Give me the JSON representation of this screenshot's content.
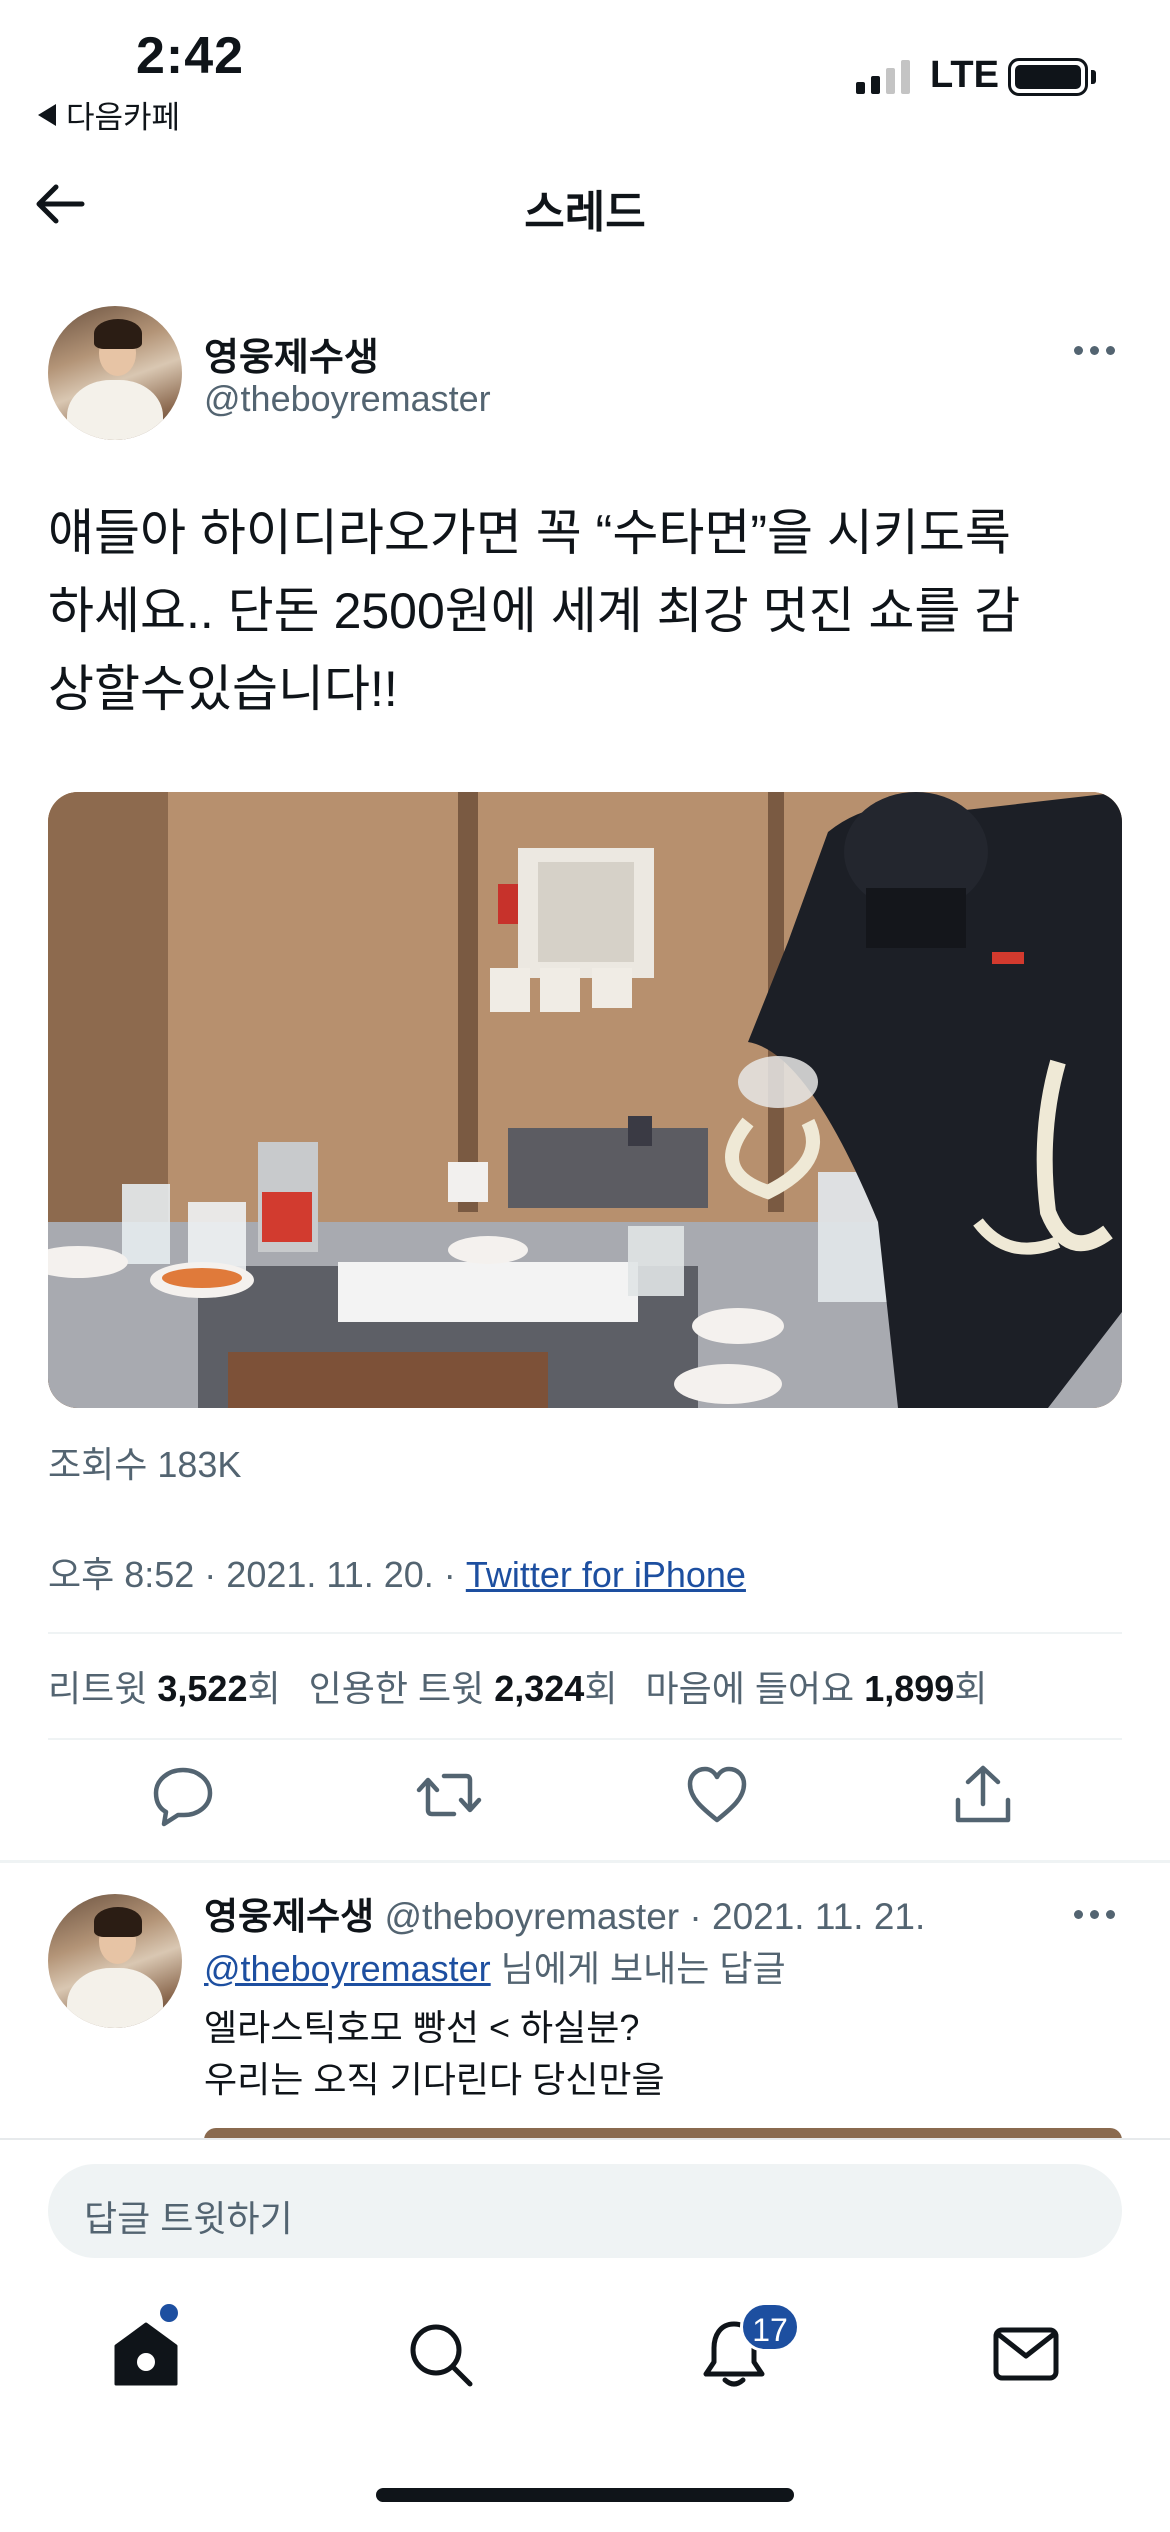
{
  "status": {
    "time": "2:42",
    "back_app": "다음카페",
    "network": "LTE"
  },
  "nav": {
    "title": "스레드"
  },
  "tweet": {
    "author_name": "영웅제수생",
    "author_handle": "@theboyremaster",
    "text_lines": [
      "얘들아 하이디라오가면 꼭 “수타면”을 시키도록",
      "하세요.. 단돈 2500원에 세계 최강 멋진 쇼를 감",
      "상할수있습니다!!"
    ],
    "views": "조회수 183K",
    "time": "오후 8:52 · 2021. 11. 20. · ",
    "source": "Twitter for iPhone",
    "stats": [
      {
        "label": "리트윗",
        "value": "3,522",
        "unit": "회"
      },
      {
        "label": "인용한 트윗",
        "value": "2,324",
        "unit": "회"
      },
      {
        "label": "마음에 들어요",
        "value": "1,899",
        "unit": "회"
      }
    ]
  },
  "reply": {
    "author_name": "영웅제수생",
    "meta": "@theboyremaster · 2021. 11. 21.",
    "reply_to_handle": "@theboyremaster",
    "reply_to_suffix": " 님에게 보내는 답글",
    "text_lines": [
      "엘라스틱호모 빵선 < 하실분?",
      "우리는 오직 기다린다 당신만을"
    ]
  },
  "compose": {
    "placeholder": "답글 트윗하기"
  },
  "tabbar": {
    "notifications_badge": "17"
  },
  "colors": {
    "link": "#1d4fa0",
    "secondary_text": "#536471",
    "primary_text": "#0f1419"
  }
}
